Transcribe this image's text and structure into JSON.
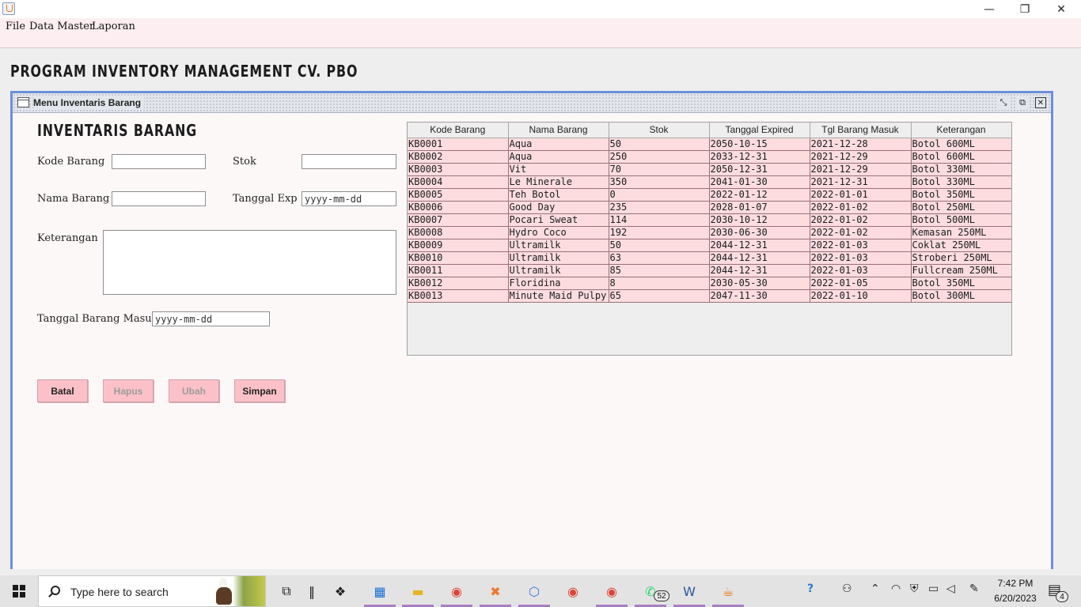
{
  "window": {
    "min_glyph": "—",
    "max_glyph": "❐",
    "close_glyph": "✕"
  },
  "menu": [
    "File",
    "Data Master",
    "Laporan"
  ],
  "app_title": "PROGRAM INVENTORY MANAGEMENT CV. PBO",
  "internal_frame": {
    "title": "Menu Inventaris Barang",
    "min_glyph": "⤡",
    "max_glyph": "⧉",
    "close_glyph": "✕"
  },
  "form": {
    "heading": "INVENTARIS BARANG",
    "kode_label": "Kode Barang",
    "kode_value": "",
    "stok_label": "Stok",
    "stok_value": "",
    "nama_label": "Nama Barang",
    "nama_value": "",
    "tgl_exp_label": "Tanggal Exp",
    "tgl_exp_value": "yyyy-mm-dd",
    "keterangan_label": "Keterangan",
    "keterangan_value": "",
    "tgl_masuk_label": "Tanggal Barang Masuk",
    "tgl_masuk_value": "yyyy-mm-dd"
  },
  "buttons": {
    "batal": "Batal",
    "hapus": "Hapus",
    "ubah": "Ubah",
    "simpan": "Simpan"
  },
  "table": {
    "columns": [
      "Kode Barang",
      "Nama Barang",
      "Stok",
      "Tanggal Expired",
      "Tgl Barang Masuk",
      "Keterangan"
    ],
    "rows": [
      [
        "KB0001",
        "Aqua",
        "50",
        "2050-10-15",
        "2021-12-28",
        "Botol 600ML"
      ],
      [
        "KB0002",
        "Aqua",
        "250",
        "2033-12-31",
        "2021-12-29",
        "Botol 600ML"
      ],
      [
        "KB0003",
        "Vit",
        "70",
        "2050-12-31",
        "2021-12-29",
        "Botol 330ML"
      ],
      [
        "KB0004",
        "Le Minerale",
        "350",
        "2041-01-30",
        "2021-12-31",
        "Botol 330ML"
      ],
      [
        "KB0005",
        "Teh Botol",
        "0",
        "2022-01-12",
        "2022-01-01",
        "Botol 350ML"
      ],
      [
        "KB0006",
        "Good Day",
        "235",
        "2028-01-07",
        "2022-01-02",
        "Botol 250ML"
      ],
      [
        "KB0007",
        "Pocari Sweat",
        "114",
        "2030-10-12",
        "2022-01-02",
        "Botol 500ML"
      ],
      [
        "KB0008",
        "Hydro Coco",
        "192",
        "2030-06-30",
        "2022-01-02",
        "Kemasan 250ML"
      ],
      [
        "KB0009",
        "Ultramilk",
        "50",
        "2044-12-31",
        "2022-01-03",
        "Coklat 250ML"
      ],
      [
        "KB0010",
        "Ultramilk",
        "63",
        "2044-12-31",
        "2022-01-03",
        "Stroberi 250ML"
      ],
      [
        "KB0011",
        "Ultramilk",
        "85",
        "2044-12-31",
        "2022-01-03",
        "Fullcream 250ML"
      ],
      [
        "KB0012",
        "Floridina",
        "8",
        "2030-05-30",
        "2022-01-05",
        "Botol 350ML"
      ],
      [
        "KB0013",
        "Minute Maid Pulpy",
        "65",
        "2047-11-30",
        "2022-01-10",
        "Botol 300ML"
      ]
    ]
  },
  "taskbar": {
    "search_placeholder": "Type here to search",
    "whatsapp_badge": "52",
    "notification_badge": "4",
    "clock_time": "7:42 PM",
    "clock_date": "6/20/2023",
    "apps": [
      {
        "name": "task-view",
        "glyph": "⧉",
        "color": "#1f1f1f"
      },
      {
        "name": "widgets",
        "glyph": "‖",
        "color": "#1f1f1f"
      },
      {
        "name": "dropbox",
        "glyph": "❖",
        "color": "#1f1f1f"
      },
      {
        "name": "microsoft-store",
        "glyph": "▦",
        "color": "#1a6fd6"
      },
      {
        "name": "file-explorer",
        "glyph": "▬",
        "color": "#e6b422"
      },
      {
        "name": "chrome",
        "glyph": "◉",
        "color": "#db4437"
      },
      {
        "name": "xampp",
        "glyph": "✖",
        "color": "#f2762e"
      },
      {
        "name": "virtualbox",
        "glyph": "⬡",
        "color": "#3a7bd5"
      },
      {
        "name": "chrome-profile",
        "glyph": "◉",
        "color": "#db4437"
      },
      {
        "name": "chrome-profile-a",
        "glyph": "◉",
        "color": "#db4437"
      },
      {
        "name": "whatsapp",
        "glyph": "✆",
        "color": "#25d366"
      },
      {
        "name": "word",
        "glyph": "W",
        "color": "#2b579a"
      },
      {
        "name": "java",
        "glyph": "☕",
        "color": "#e76f00"
      }
    ]
  }
}
